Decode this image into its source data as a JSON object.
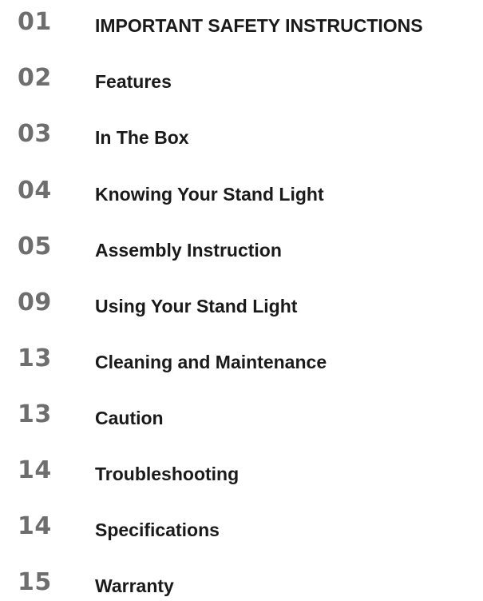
{
  "toc": {
    "entries": [
      {
        "page": "01",
        "title": "IMPORTANT SAFETY INSTRUCTIONS"
      },
      {
        "page": "02",
        "title": "Features"
      },
      {
        "page": "03",
        "title": "In The Box"
      },
      {
        "page": "04",
        "title": "Knowing Your Stand Light"
      },
      {
        "page": "05",
        "title": "Assembly Instruction"
      },
      {
        "page": "09",
        "title": "Using Your Stand Light"
      },
      {
        "page": "13",
        "title": "Cleaning and Maintenance"
      },
      {
        "page": "13",
        "title": "Caution"
      },
      {
        "page": "14",
        "title": "Troubleshooting"
      },
      {
        "page": "14",
        "title": "Specifications"
      },
      {
        "page": "15",
        "title": "Warranty"
      }
    ]
  },
  "colors": {
    "page_number": "#6e6e6e",
    "title": "#1a1a1a",
    "background": "#ffffff"
  }
}
